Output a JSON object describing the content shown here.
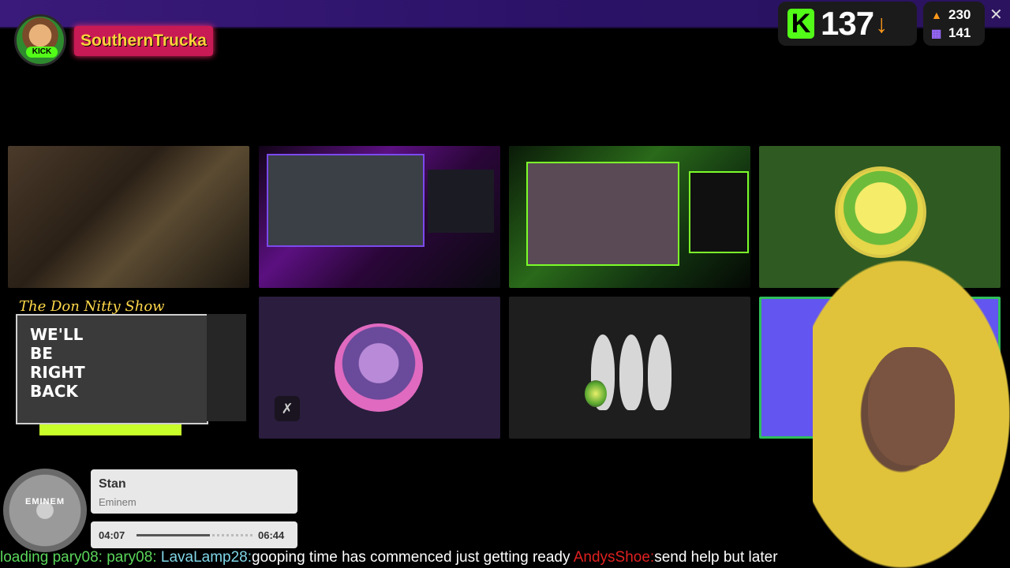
{
  "streamer": {
    "name": "SouthernTrucka",
    "avatar_badge": "KICK"
  },
  "viewers": {
    "count": "137",
    "trend_icon": "arrow-down-icon"
  },
  "stats": {
    "followers": "230",
    "subs": "141"
  },
  "tiles": {
    "show_title": "The Don Nitty Show",
    "brb_text": "WE'LL BE RIGHT BACK"
  },
  "now_playing": {
    "title": "Stan",
    "artist": "Eminem",
    "album_label": "EMINEM",
    "current": "04:07",
    "total": "06:44",
    "progress": 0.63
  },
  "chat": [
    {
      "user": "",
      "text": "loading",
      "color": "green"
    },
    {
      "user": "pary08:",
      "text": "",
      "color": "green"
    },
    {
      "user": "pary08:",
      "text": "",
      "color": "green"
    },
    {
      "user": "LavaLamp28:",
      "text": "gooping time has commenced just getting ready",
      "color": "blue"
    },
    {
      "user": "AndysShoe:",
      "text": "send help but later",
      "color": "red"
    }
  ],
  "colors": {
    "topbar": "#3a1a7a",
    "kick_green": "#53fc18",
    "badge": "#c81a55",
    "name_text": "#ffd23a"
  }
}
